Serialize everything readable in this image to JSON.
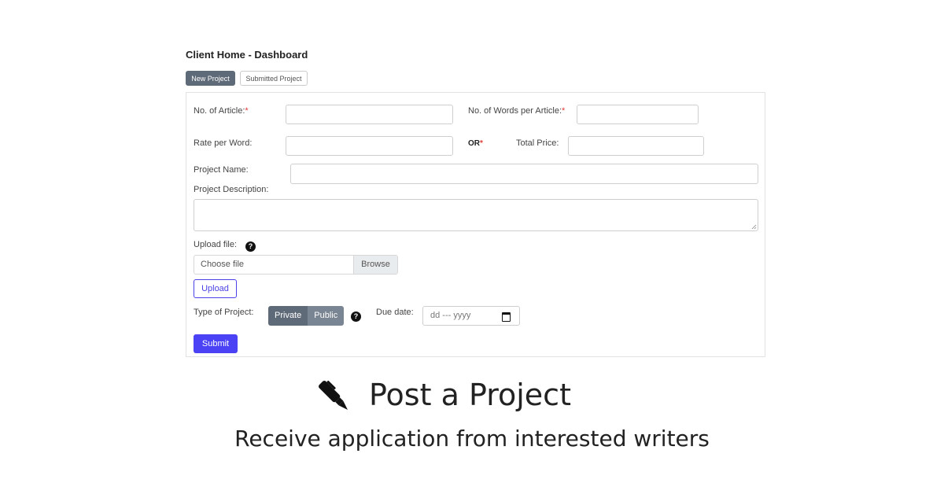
{
  "header": {
    "title": "Client Home - Dashboard"
  },
  "tabs": [
    {
      "label": "New Project",
      "active": true
    },
    {
      "label": "Submitted Project",
      "active": false
    }
  ],
  "form": {
    "num_articles_label": "No. of Article:",
    "words_per_article_label": "No. of Words per Article:",
    "required_mark": "*",
    "rate_per_word_label": "Rate per Word:",
    "or_label": "OR",
    "total_price_label": "Total Price:",
    "project_name_label": "Project Name:",
    "project_description_label": "Project Description:",
    "upload_file_label": "Upload file:",
    "file_placeholder": "Choose file",
    "browse_label": "Browse",
    "upload_button": "Upload",
    "type_label": "Type of Project:",
    "type_options": [
      "Private",
      "Public"
    ],
    "type_selected": "Private",
    "due_date_label": "Due date:",
    "due_date_placeholder": "dd --- yyyy",
    "submit_button": "Submit",
    "help_icon": "question-circle-icon"
  },
  "promo": {
    "icon": "pen-icon",
    "headline": "Post a Project",
    "subline": "Receive application from interested writers"
  },
  "colors": {
    "primary": "#4a42f4",
    "tab_active": "#5f6a78",
    "required": "#e23a3a"
  }
}
